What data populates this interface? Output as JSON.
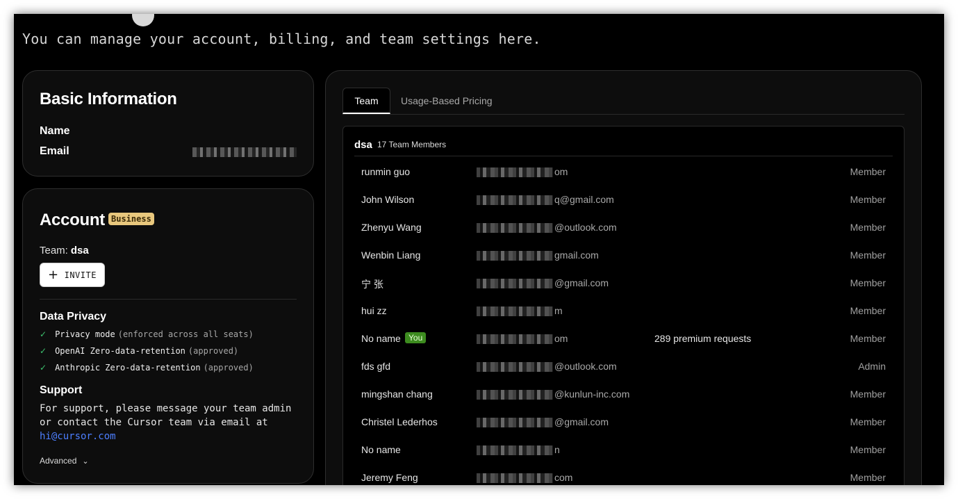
{
  "header": {
    "subtitle": "You can manage your account, billing, and team settings here."
  },
  "basic_info": {
    "title": "Basic Information",
    "name_label": "Name",
    "email_label": "Email"
  },
  "account": {
    "title": "Account",
    "plan_badge": "Business",
    "team_label": "Team:",
    "team_name": "dsa",
    "invite_label": "INVITE",
    "data_privacy": {
      "title": "Data Privacy",
      "items": [
        {
          "label": "Privacy mode",
          "note": "(enforced across all seats)"
        },
        {
          "label": "OpenAI Zero-data-retention",
          "note": "(approved)"
        },
        {
          "label": "Anthropic Zero-data-retention",
          "note": "(approved)"
        }
      ]
    },
    "support": {
      "title": "Support",
      "text": "For support, please message your team admin or contact the Cursor team via email at",
      "email": "hi@cursor.com"
    },
    "advanced_label": "Advanced"
  },
  "team_panel": {
    "tabs": [
      {
        "label": "Team",
        "active": true
      },
      {
        "label": "Usage-Based Pricing",
        "active": false
      }
    ],
    "team_name": "dsa",
    "member_count": "17 Team Members",
    "members": [
      {
        "name": "runmin guo",
        "email_suffix": "om",
        "usage": "",
        "role": "Member",
        "you": false
      },
      {
        "name": "John Wilson",
        "email_suffix": "q@gmail.com",
        "usage": "",
        "role": "Member",
        "you": false
      },
      {
        "name": "Zhenyu Wang",
        "email_suffix": "@outlook.com",
        "usage": "",
        "role": "Member",
        "you": false
      },
      {
        "name": "Wenbin Liang",
        "email_suffix": "gmail.com",
        "usage": "",
        "role": "Member",
        "you": false
      },
      {
        "name": "宁 张",
        "email_suffix": "@gmail.com",
        "usage": "",
        "role": "Member",
        "you": false
      },
      {
        "name": "hui zz",
        "email_suffix": "m",
        "usage": "",
        "role": "Member",
        "you": false
      },
      {
        "name": "No name",
        "email_suffix": "om",
        "usage": "289 premium requests",
        "role": "Member",
        "you": true,
        "you_label": "You"
      },
      {
        "name": "fds gfd",
        "email_suffix": "@outlook.com",
        "usage": "",
        "role": "Admin",
        "you": false
      },
      {
        "name": "mingshan chang",
        "email_suffix": "@kunlun-inc.com",
        "usage": "",
        "role": "Member",
        "you": false
      },
      {
        "name": "Christel Lederhos",
        "email_suffix": "@gmail.com",
        "usage": "",
        "role": "Member",
        "you": false
      },
      {
        "name": "No name",
        "email_suffix": "n",
        "usage": "",
        "role": "Member",
        "you": false
      },
      {
        "name": "Jeremy Feng",
        "email_suffix": "com",
        "usage": "",
        "role": "Member",
        "you": false
      }
    ]
  }
}
